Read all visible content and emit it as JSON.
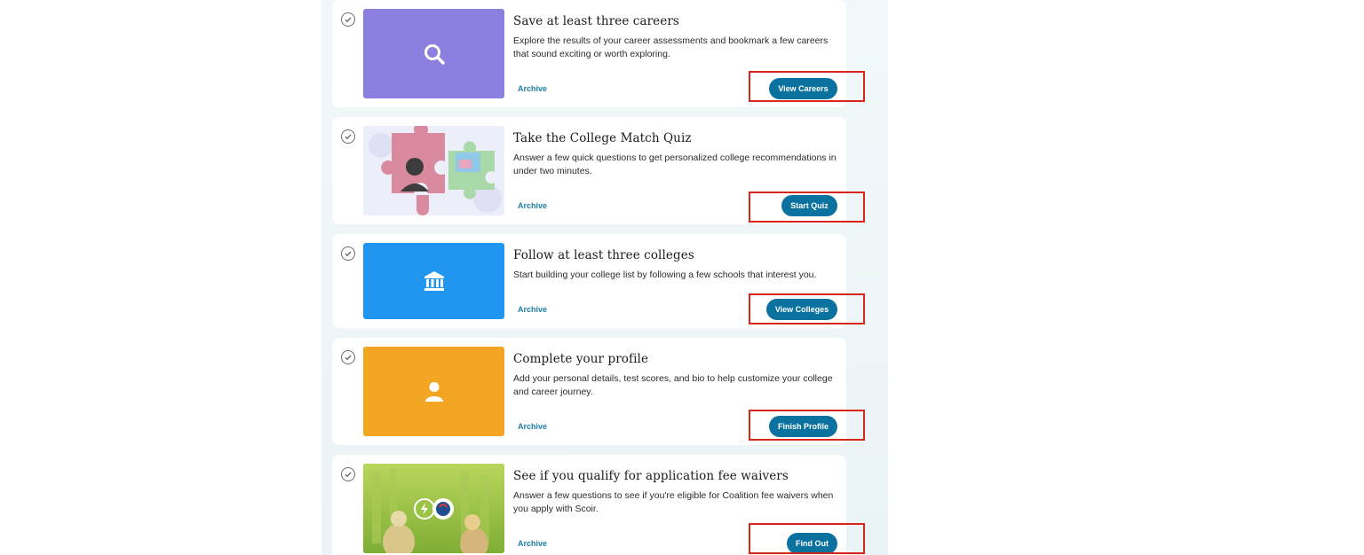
{
  "cards": [
    {
      "title": "Save at least three careers",
      "description": "Explore the results of your career assessments and bookmark a few careers that sound exciting or worth exploring.",
      "archive_label": "Archive",
      "cta_label": "View Careers",
      "thumb_icon": "search-icon",
      "thumb_color": "#8b7fe0"
    },
    {
      "title": "Take the College Match Quiz",
      "description": "Answer a few quick questions to get personalized college recommendations in under two minutes.",
      "archive_label": "Archive",
      "cta_label": "Start Quiz",
      "thumb_icon": "puzzle-illustration",
      "thumb_color": "#eef0f8"
    },
    {
      "title": "Follow at least three colleges",
      "description": "Start building your college list by following a few schools that interest you.",
      "archive_label": "Archive",
      "cta_label": "View Colleges",
      "thumb_icon": "college-building-icon",
      "thumb_color": "#2196f0"
    },
    {
      "title": "Complete your profile",
      "description": "Add your personal details, test scores, and bio to help customize your college and career journey.",
      "archive_label": "Archive",
      "cta_label": "Finish Profile",
      "thumb_icon": "person-icon",
      "thumb_color": "#f2a623"
    },
    {
      "title": "See if you qualify for application fee waivers",
      "description": "Answer a few questions to see if you're eligible for Coalition fee waivers when you apply with Scoir.",
      "archive_label": "Archive",
      "cta_label": "Find Out",
      "thumb_icon": "campus-photo",
      "thumb_color": "#9cc443"
    }
  ],
  "colors": {
    "accent": "#0b72a0",
    "link": "#1e7fa6",
    "highlight_box": "#d9261c"
  }
}
